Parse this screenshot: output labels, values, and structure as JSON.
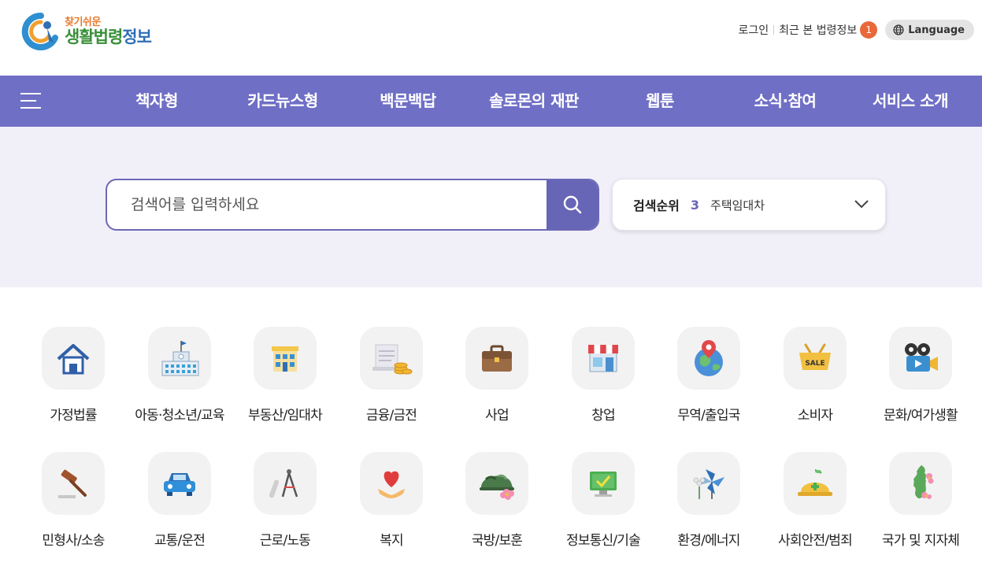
{
  "header": {
    "logo": {
      "small": "찾기쉬운",
      "big_a": "생활법령",
      "big_b": "정보"
    },
    "login_label": "로그인",
    "recent_label": "최근 본 법령정보",
    "recent_count": "1",
    "language_label": "Language"
  },
  "nav": {
    "menu_icon": "hamburger-icon",
    "items": [
      {
        "label": "책자형"
      },
      {
        "label": "카드뉴스형"
      },
      {
        "label": "백문백답"
      },
      {
        "label": "솔로몬의 재판"
      },
      {
        "label": "웹툰"
      },
      {
        "label": "소식·참여"
      },
      {
        "label": "서비스 소개"
      }
    ]
  },
  "search": {
    "placeholder": "검색어를 입력하세요",
    "button_icon": "search-icon",
    "ranking_label": "검색순위",
    "ranking_number": "3",
    "ranking_term": "주택임대차"
  },
  "categories": [
    {
      "label": "가정법률",
      "icon": "house-icon"
    },
    {
      "label": "아동·청소년/교육",
      "icon": "school-icon"
    },
    {
      "label": "부동산/임대차",
      "icon": "building-icon"
    },
    {
      "label": "금융/금전",
      "icon": "money-icon"
    },
    {
      "label": "사업",
      "icon": "briefcase-icon"
    },
    {
      "label": "창업",
      "icon": "storefront-icon"
    },
    {
      "label": "무역/출입국",
      "icon": "globe-pin-icon"
    },
    {
      "label": "소비자",
      "icon": "shopping-basket-icon"
    },
    {
      "label": "문화/여가생활",
      "icon": "film-camera-icon"
    },
    {
      "label": "민형사/소송",
      "icon": "gavel-icon"
    },
    {
      "label": "교통/운전",
      "icon": "car-icon"
    },
    {
      "label": "근로/노동",
      "icon": "compass-tools-icon"
    },
    {
      "label": "복지",
      "icon": "heart-hand-icon"
    },
    {
      "label": "국방/보훈",
      "icon": "military-cap-icon"
    },
    {
      "label": "정보통신/기술",
      "icon": "monitor-icon"
    },
    {
      "label": "환경/에너지",
      "icon": "windmill-icon"
    },
    {
      "label": "사회안전/범죄",
      "icon": "safety-helmet-icon"
    },
    {
      "label": "국가 및 지자체",
      "icon": "korea-map-icon"
    }
  ],
  "colors": {
    "nav_bg": "#6f6fc6",
    "search_border": "#6c68b6",
    "search_band_bg": "#f1f0f8",
    "badge": "#e8683a"
  }
}
